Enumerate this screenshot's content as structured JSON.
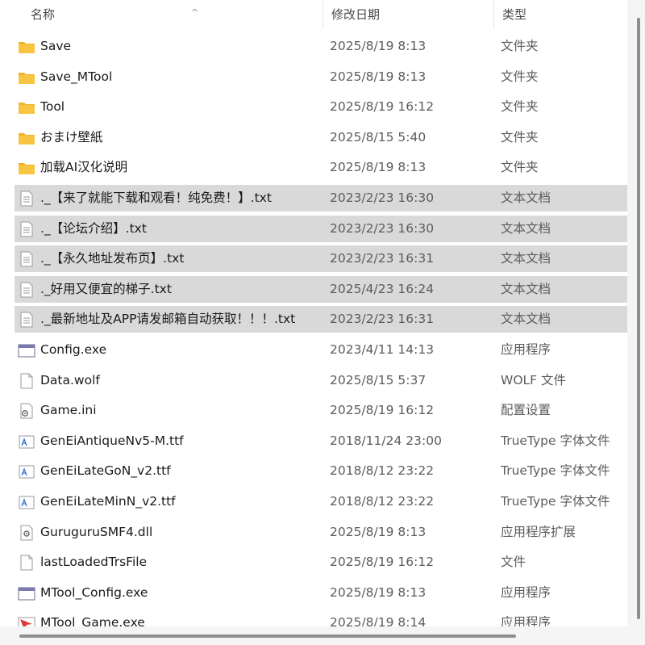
{
  "columns": {
    "name": "名称",
    "date_modified": "修改日期",
    "type": "类型",
    "sort_indicator": "^"
  },
  "files": [
    {
      "name": "Save",
      "date": "2025/8/19 8:13",
      "type": "文件夹",
      "icon": "folder-icon",
      "selected": false
    },
    {
      "name": "Save_MTool",
      "date": "2025/8/19 8:13",
      "type": "文件夹",
      "icon": "folder-icon",
      "selected": false
    },
    {
      "name": "Tool",
      "date": "2025/8/19 16:12",
      "type": "文件夹",
      "icon": "folder-icon",
      "selected": false
    },
    {
      "name": "おまけ壁紙",
      "date": "2025/8/15 5:40",
      "type": "文件夹",
      "icon": "folder-icon",
      "selected": false
    },
    {
      "name": "加载AI汉化说明",
      "date": "2025/8/19 8:13",
      "type": "文件夹",
      "icon": "folder-icon",
      "selected": false
    },
    {
      "name": "._【来了就能下载和观看！纯免费！】.txt",
      "date": "2023/2/23 16:30",
      "type": "文本文档",
      "icon": "text-file-icon",
      "selected": true
    },
    {
      "name": "._【论坛介绍】.txt",
      "date": "2023/2/23 16:30",
      "type": "文本文档",
      "icon": "text-file-icon",
      "selected": true
    },
    {
      "name": "._【永久地址发布页】.txt",
      "date": "2023/2/23 16:31",
      "type": "文本文档",
      "icon": "text-file-icon",
      "selected": true
    },
    {
      "name": "._好用又便宜的梯子.txt",
      "date": "2025/4/23 16:24",
      "type": "文本文档",
      "icon": "text-file-icon",
      "selected": true
    },
    {
      "name": "._最新地址及APP请发邮箱自动获取！！！.txt",
      "date": "2023/2/23 16:31",
      "type": "文本文档",
      "icon": "text-file-icon",
      "selected": true
    },
    {
      "name": "Config.exe",
      "date": "2023/4/11 14:13",
      "type": "应用程序",
      "icon": "app-window-icon",
      "selected": false
    },
    {
      "name": "Data.wolf",
      "date": "2025/8/15 5:37",
      "type": "WOLF 文件",
      "icon": "blank-file-icon",
      "selected": false
    },
    {
      "name": "Game.ini",
      "date": "2025/8/19 16:12",
      "type": "配置设置",
      "icon": "settings-file-icon",
      "selected": false
    },
    {
      "name": "GenEiAntiqueNv5-M.ttf",
      "date": "2018/11/24 23:00",
      "type": "TrueType 字体文件",
      "icon": "font-file-icon",
      "selected": false
    },
    {
      "name": "GenEiLateGoN_v2.ttf",
      "date": "2018/8/12 23:22",
      "type": "TrueType 字体文件",
      "icon": "font-file-icon",
      "selected": false
    },
    {
      "name": "GenEiLateMinN_v2.ttf",
      "date": "2018/8/12 23:22",
      "type": "TrueType 字体文件",
      "icon": "font-file-icon",
      "selected": false
    },
    {
      "name": "GuruguruSMF4.dll",
      "date": "2025/8/19 8:13",
      "type": "应用程序扩展",
      "icon": "dll-file-icon",
      "selected": false
    },
    {
      "name": "lastLoadedTrsFile",
      "date": "2025/8/19 16:12",
      "type": "文件",
      "icon": "blank-file-icon",
      "selected": false
    },
    {
      "name": "MTool_Config.exe",
      "date": "2025/8/19 8:13",
      "type": "应用程序",
      "icon": "app-window-icon",
      "selected": false
    },
    {
      "name": "MTool_Game.exe",
      "date": "2025/8/19 8:14",
      "type": "应用程序",
      "icon": "game-app-icon",
      "selected": false
    }
  ],
  "colors": {
    "selection": "#d9d9d9",
    "folder": "#f8c542",
    "secondary_text": "#5c5c5c",
    "scrollbar_thumb": "#8e8e8e"
  }
}
